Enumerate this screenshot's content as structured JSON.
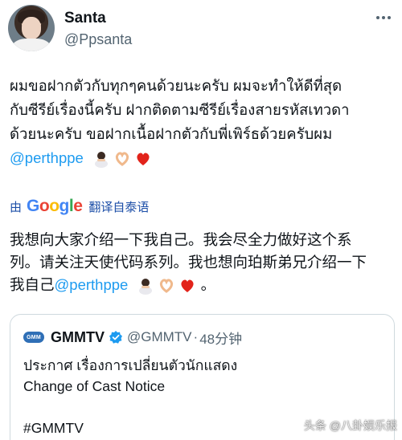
{
  "author": {
    "display_name": "Santa",
    "handle": "@Ppsanta"
  },
  "tweet": {
    "lines": [
      "ผมขอฝากตัวกับทุกๆคนด้วยนะครับ ผมจะทำให้ดีที่สุด",
      "กับซีรีย์เรื่องนี้ครับ ฝากติดตามซีรีย์เรื่องสายรหัสเทวดา",
      "ด้วยนะครับ ขอฝากเนื้อฝากตัวกับพี่เพิร์ธด้วยครับผม"
    ],
    "mention": "@perthppe",
    "emojis": [
      "person-bowing-emoji",
      "heart-hands-emoji",
      "red-heart-emoji"
    ]
  },
  "translation": {
    "by": "由",
    "provider": "Google",
    "label": "翻译自泰语",
    "lines": [
      "我想向大家介绍一下我自己。我会尽全力做好这个系",
      "列。请关注天使代码系列。我也想向珀斯弟兄介绍一下"
    ],
    "last_line_prefix": "我自己",
    "mention": "@perthppe",
    "last_line_suffix": "。"
  },
  "quoted_tweet": {
    "logo_text": "GMM",
    "name": "GMMTV",
    "handle": "@GMMTV",
    "separator": "·",
    "time": "48分钟",
    "lines": [
      "ประกาศ เรื่องการเปลี่ยนตัวนักแสดง",
      "Change of Cast Notice"
    ],
    "hashtag": "#GMMTV"
  },
  "watermark": {
    "text": "头条 @八卦娱乐报"
  },
  "colors": {
    "link": "#1d9bf0",
    "text": "#0f1419",
    "muted": "#536471",
    "border": "#cfd9de"
  }
}
